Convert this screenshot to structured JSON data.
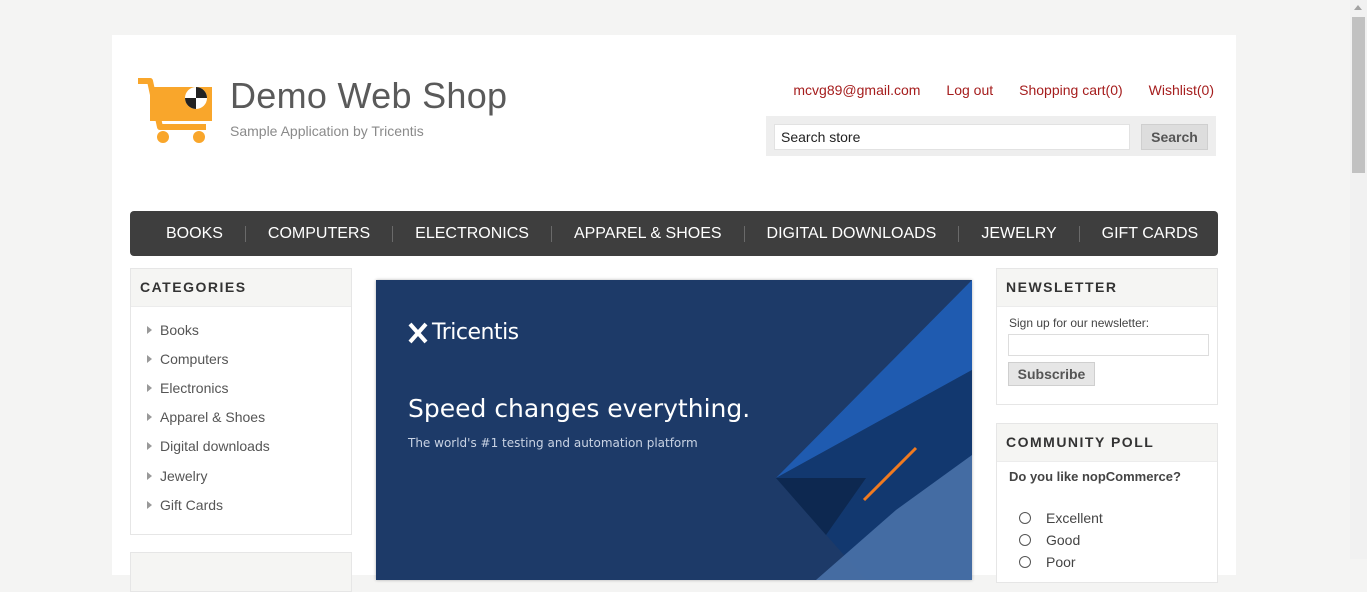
{
  "logo": {
    "name": "Demo Web Shop",
    "tagline": "Sample Application by Tricentis"
  },
  "header_links": {
    "account": "mcvg89@gmail.com",
    "logout": "Log out",
    "cart": "Shopping cart(0)",
    "wishlist": "Wishlist(0)"
  },
  "search": {
    "value": "Search store",
    "button": "Search"
  },
  "menu": [
    "BOOKS",
    "COMPUTERS",
    "ELECTRONICS",
    "APPAREL & SHOES",
    "DIGITAL DOWNLOADS",
    "JEWELRY",
    "GIFT CARDS"
  ],
  "categories": {
    "title": "CATEGORIES",
    "items": [
      "Books",
      "Computers",
      "Electronics",
      "Apparel & Shoes",
      "Digital downloads",
      "Jewelry",
      "Gift Cards"
    ]
  },
  "banner": {
    "brand": "Tricentis",
    "headline": "Speed changes everything.",
    "sub": "The world's #1 testing and automation platform"
  },
  "newsletter": {
    "title": "NEWSLETTER",
    "label": "Sign up for our newsletter:",
    "button": "Subscribe"
  },
  "poll": {
    "title": "COMMUNITY POLL",
    "question": "Do you like nopCommerce?",
    "options": [
      "Excellent",
      "Good",
      "Poor"
    ]
  },
  "colors": {
    "link": "#a51d1d",
    "menu_bg": "#3e3e3e",
    "logo_orange": "#f9a62b",
    "banner_bg": "#1d3a68"
  }
}
